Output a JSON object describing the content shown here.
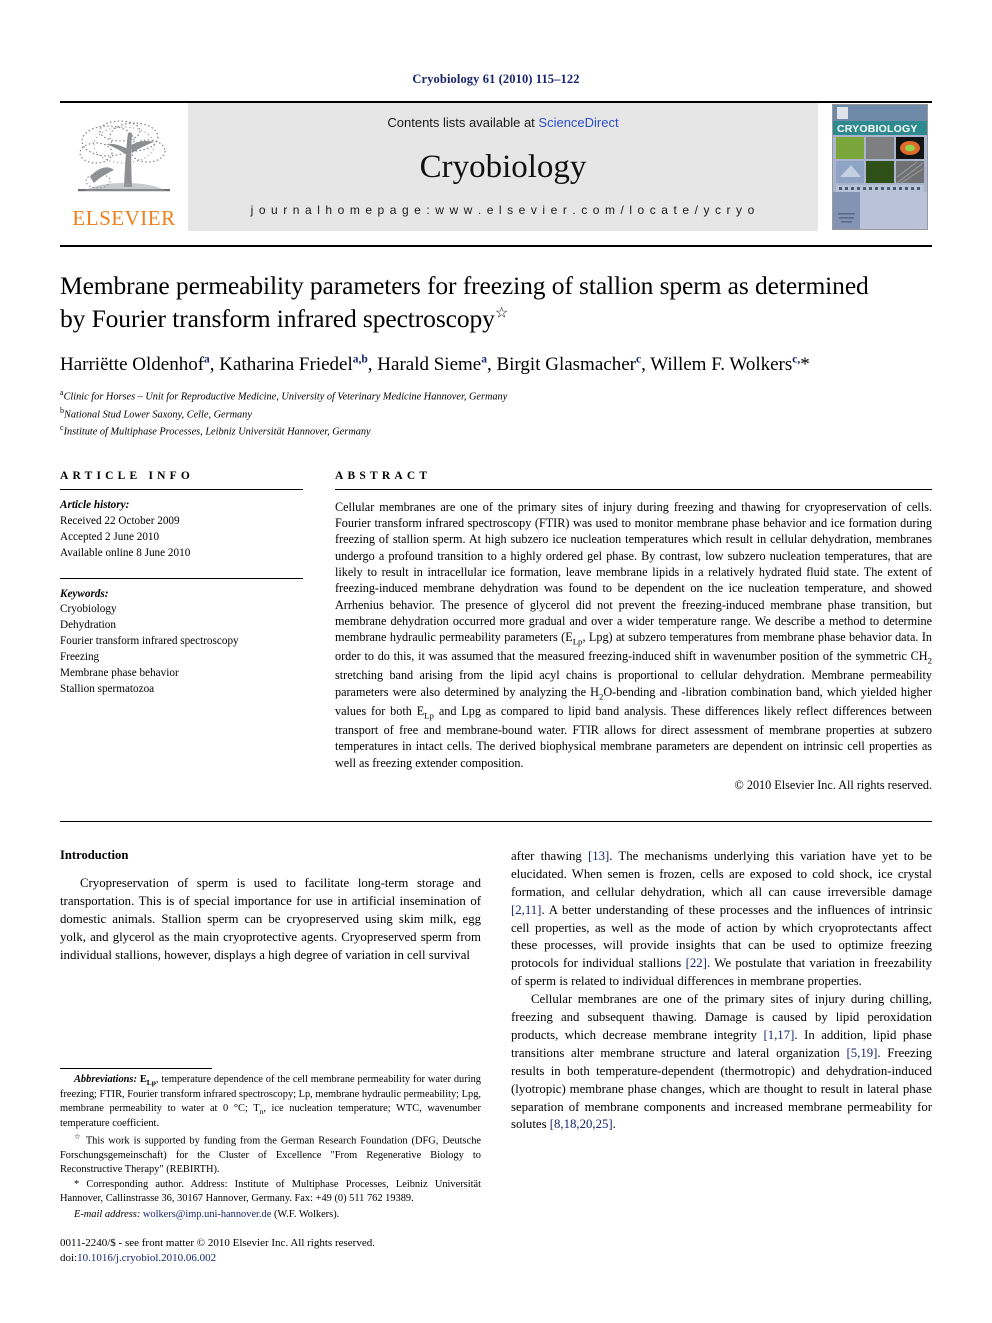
{
  "running_head": "Cryobiology 61 (2010) 115–122",
  "masthead": {
    "publisher_name": "ELSEVIER",
    "contents_prefix": "Contents lists available at ",
    "contents_link": "ScienceDirect",
    "journal_name": "Cryobiology",
    "homepage": "j o u r n a l   h o m e p a g e :   w w w . e l s e v i e r . c o m / l o c a t e / y c r y o",
    "cover_title": "CRYOBIOLOGY"
  },
  "article": {
    "title_line1": "Membrane permeability parameters for freezing of stallion sperm as determined",
    "title_line2": "by Fourier transform infrared spectroscopy",
    "title_marker": "☆",
    "authors_html": "Harriëtte Oldenhof<sup>a</sup>, Katharina Friedel<sup>a,b</sup>, Harald Sieme<sup>a</sup>, Birgit Glasmacher<sup>c</sup>, Willem F. Wolkers<sup>c,</sup>*",
    "affiliations": [
      {
        "marker": "a",
        "text": "Clinic for Horses – Unit for Reproductive Medicine, University of Veterinary Medicine Hannover, Germany"
      },
      {
        "marker": "b",
        "text": "National Stud Lower Saxony, Celle, Germany"
      },
      {
        "marker": "c",
        "text": "Institute of Multiphase Processes, Leibniz Universität Hannover, Germany"
      }
    ]
  },
  "article_info": {
    "label": "ARTICLE INFO",
    "history_heading": "Article history:",
    "history": [
      "Received 22 October 2009",
      "Accepted 2 June 2010",
      "Available online 8 June 2010"
    ],
    "keywords_heading": "Keywords:",
    "keywords": [
      "Cryobiology",
      "Dehydration",
      "Fourier transform infrared spectroscopy",
      "Freezing",
      "Membrane phase behavior",
      "Stallion spermatozoa"
    ]
  },
  "abstract": {
    "label": "ABSTRACT",
    "text_html": "Cellular membranes are one of the primary sites of injury during freezing and thawing for cryopreservation of cells. Fourier transform infrared spectroscopy (FTIR) was used to monitor membrane phase behavior and ice formation during freezing of stallion sperm. At high subzero ice nucleation temperatures which result in cellular dehydration, membranes undergo a profound transition to a highly ordered gel phase. By contrast, low subzero nucleation temperatures, that are likely to result in intracellular ice formation, leave membrane lipids in a relatively hydrated fluid state. The extent of freezing-induced membrane dehydration was found to be dependent on the ice nucleation temperature, and showed Arrhenius behavior. The presence of glycerol did not prevent the freezing-induced membrane phase transition, but membrane dehydration occurred more gradual and over a wider temperature range. We describe a method to determine membrane hydraulic permeability parameters (E<sub>Lp</sub>, Lpg) at subzero temperatures from membrane phase behavior data. In order to do this, it was assumed that the measured freezing-induced shift in wavenumber position of the symmetric CH<sub>2</sub> stretching band arising from the lipid acyl chains is proportional to cellular dehydration. Membrane permeability parameters were also determined by analyzing the H<sub>2</sub>O-bending and -libration combination band, which yielded higher values for both E<sub>Lp</sub> and Lpg as compared to lipid band analysis. These differences likely reflect differences between transport of free and membrane-bound water. FTIR allows for direct assessment of membrane properties at subzero temperatures in intact cells. The derived biophysical membrane parameters are dependent on intrinsic cell properties as well as freezing extender composition.",
    "copyright": "© 2010 Elsevier Inc. All rights reserved."
  },
  "body": {
    "heading": "Introduction",
    "left_paragraphs_html": [
      "Cryopreservation of sperm is used to facilitate long-term storage and transportation. This is of special importance for use in artificial insemination of domestic animals. Stallion sperm can be cryopreserved using skim milk, egg yolk, and glycerol as the main cryoprotective agents. Cryopreserved sperm from individual stallions, however, displays a high degree of variation in cell survival"
    ],
    "right_paragraphs_html": [
      "after thawing <span class=\"cite\">[13]</span>. The mechanisms underlying this variation have yet to be elucidated. When semen is frozen, cells are exposed to cold shock, ice crystal formation, and cellular dehydration, which all can cause irreversible damage <span class=\"cite\">[2,11]</span>. A better understanding of these processes and the influences of intrinsic cell properties, as well as the mode of action by which cryoprotectants affect these processes, will provide insights that can be used to optimize freezing protocols for individual stallions <span class=\"cite\">[22]</span>. We postulate that variation in freezability of sperm is related to individual differences in membrane properties.",
      "Cellular membranes are one of the primary sites of injury during chilling, freezing and subsequent thawing. Damage is caused by lipid peroxidation products, which decrease membrane integrity <span class=\"cite\">[1,17]</span>. In addition, lipid phase transitions alter membrane structure and lateral organization <span class=\"cite\">[5,19]</span>. Freezing results in both temperature-dependent (thermotropic) and dehydration-induced (lyotropic) membrane phase changes, which are thought to result in lateral phase separation of membrane components and increased membrane permeability for solutes <span class=\"cite\">[8,18,20,25]</span>."
    ]
  },
  "footnotes": {
    "abbreviations_html": "<i><b>Abbreviations:</b></i> <b>E<sub>Lp</sub></b>, temperature dependence of the cell membrane permeability for water during freezing; FTIR, Fourier transform infrared spectroscopy; Lp, membrane hydraulic permeability; Lpg, membrane permeability to water at 0 °C; T<sub>n</sub>, ice nucleation temperature; WTC, wavenumber temperature coefficient.",
    "funding_html": "<sup class=\"ref\">☆</sup> This work is supported by funding from the German Research Foundation (DFG, Deutsche Forschungsgemeinschaft) for the Cluster of Excellence \"From Regenerative Biology to Reconstructive Therapy\" (REBIRTH).",
    "corresponding_html": "* Corresponding author. Address: Institute of Multiphase Processes, Leibniz Universität Hannover, Callinstrasse 36, 30167 Hannover, Germany. Fax: +49 (0) 511 762 19389.",
    "email_label": "E-mail address:",
    "email_link": "wolkers@imp.uni-hannover.de",
    "email_suffix": " (W.F. Wolkers).",
    "issn_line": "0011-2240/$ - see front matter © 2010 Elsevier Inc. All rights reserved.",
    "doi_prefix": "doi:",
    "doi_link": "10.1016/j.cryobiol.2010.06.002"
  },
  "colors": {
    "link_blue": "#16256b",
    "sciencedirect_blue": "#2b4fc8",
    "elsevier_orange": "#ef7d1a",
    "banner_gray": "#e6e6e6",
    "cover_teal": "#2f8a8f"
  }
}
